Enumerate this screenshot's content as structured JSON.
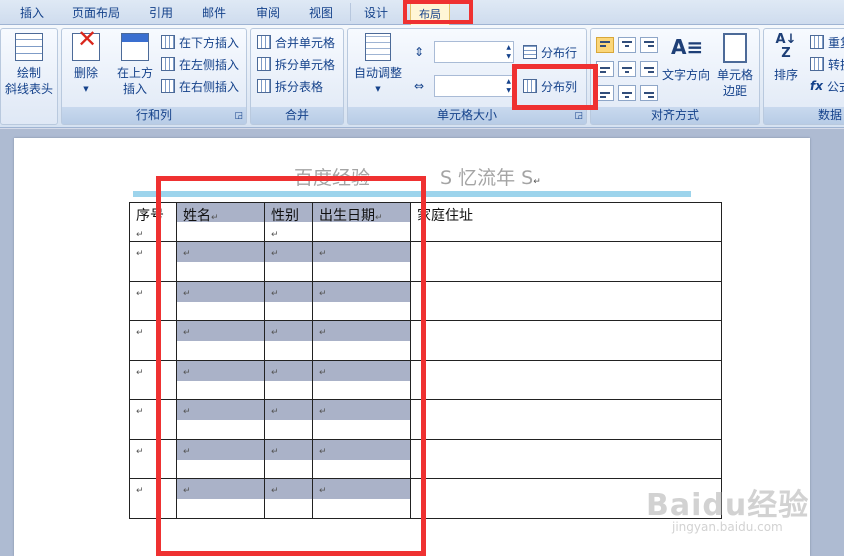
{
  "ribbon_tabs": [
    {
      "label": "插入"
    },
    {
      "label": "页面布局"
    },
    {
      "label": "引用"
    },
    {
      "label": "邮件"
    },
    {
      "label": "审阅"
    },
    {
      "label": "视图"
    },
    {
      "label": "设计"
    },
    {
      "label": "布局",
      "active": true
    }
  ],
  "groups": {
    "draw": {
      "draw_diag_label_1": "绘制",
      "draw_diag_label_2": "斜线表头"
    },
    "rows_cols": {
      "label": "行和列",
      "delete": "删除",
      "insert_above_1": "在上方",
      "insert_above_2": "插入",
      "insert_below": "在下方插入",
      "insert_left": "在左侧插入",
      "insert_right": "在右侧插入"
    },
    "merge": {
      "label": "合并",
      "merge_cells": "合并单元格",
      "split_cells": "拆分单元格",
      "split_table": "拆分表格"
    },
    "cell_size": {
      "label": "单元格大小",
      "autofit": "自动调整",
      "distribute_rows": "分布行",
      "distribute_cols": "分布列"
    },
    "alignment": {
      "label": "对齐方式",
      "text_direction": "文字方向",
      "margins_1": "单元格",
      "margins_2": "边距"
    },
    "data": {
      "label": "数据",
      "sort": "排序",
      "repeat_header": "重复",
      "convert": "转换",
      "formula": "公式"
    }
  },
  "document": {
    "heading_left": "百度经验",
    "heading_right": "S 忆流年 S",
    "table": {
      "headers": [
        "序号",
        "姓名",
        "性别",
        "出生日期",
        "家庭住址"
      ],
      "empty_rows": 7
    },
    "para_mark": "↵"
  },
  "watermark": {
    "brand": "Baidu经验",
    "url": "jingyan.baidu.com"
  },
  "colors": {
    "highlight": "#ef3131",
    "selection_shade": "#aab2c8",
    "heading_rule": "#9dd4ec"
  }
}
